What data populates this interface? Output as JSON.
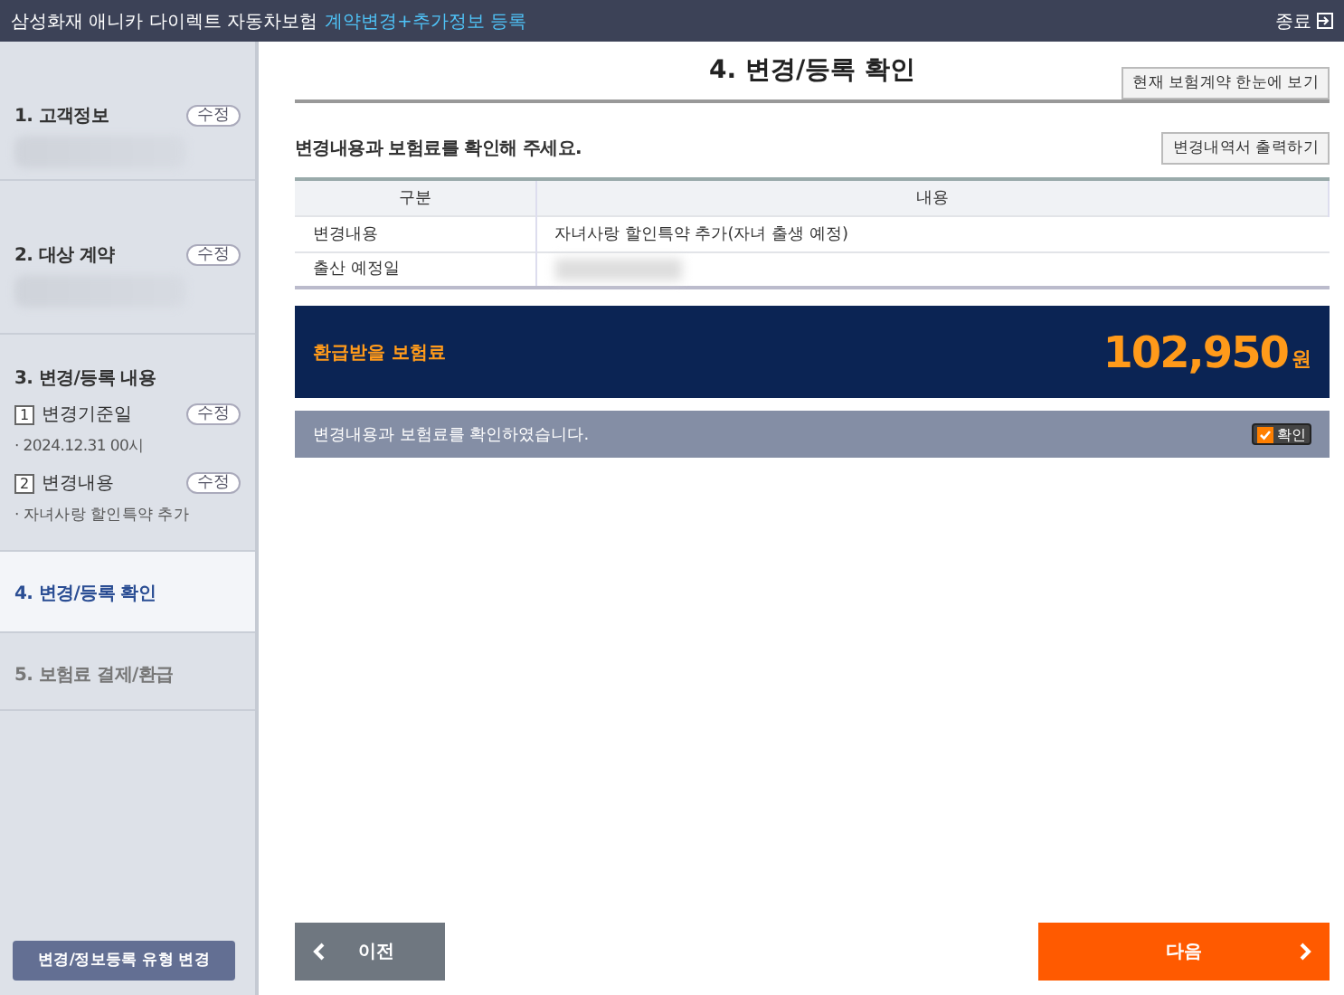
{
  "header": {
    "title": "삼성화재 애니카 다이렉트 자동차보험",
    "subtitle": "계약변경+추가정보 등록",
    "close": "종료"
  },
  "sidebar": {
    "steps": [
      {
        "label": "1. 고객정보",
        "edit": "수정",
        "blurred": true,
        "selected": false,
        "disabled": false
      },
      {
        "label": "2. 대상 계약",
        "edit": "수정",
        "blurred": true,
        "selected": false,
        "disabled": false
      },
      {
        "label": "3. 변경/등록 내용",
        "selected": false,
        "disabled": false,
        "children": [
          {
            "number": "1",
            "label": "변경기준일",
            "edit": "수정",
            "detail": "· 2024.12.31 00시"
          },
          {
            "number": "2",
            "label": "변경내용",
            "edit": "수정",
            "detail": "· 자녀사랑 할인특약 추가"
          }
        ]
      },
      {
        "label": "4. 변경/등록 확인",
        "selected": true,
        "disabled": false
      },
      {
        "label": "5. 보험료 결제/환급",
        "selected": false,
        "disabled": true
      }
    ],
    "bottom_button": "변경/정보등록 유형 변경"
  },
  "main": {
    "title": "4. 변경/등록 확인",
    "view_button": "현재 보험계약 한눈에 보기",
    "instruction": "변경내용과 보험료를 확인해 주세요.",
    "print_button": "변경내역서 출력하기",
    "table": {
      "columns": [
        "구분",
        "내용"
      ],
      "rows": [
        {
          "label": "변경내용",
          "value": "자녀사랑 할인특약 추가(자녀 출생 예정)",
          "blurred": false
        },
        {
          "label": "출산 예정일",
          "blurred": true
        }
      ]
    },
    "refund": {
      "label": "환급받을 보험료",
      "amount": "102,950",
      "unit": "원"
    },
    "confirm": {
      "text": "변경내용과 보험료를 확인하였습니다.",
      "label": "확인",
      "checked": true
    },
    "prev_button": "이전",
    "next_button": "다음"
  }
}
